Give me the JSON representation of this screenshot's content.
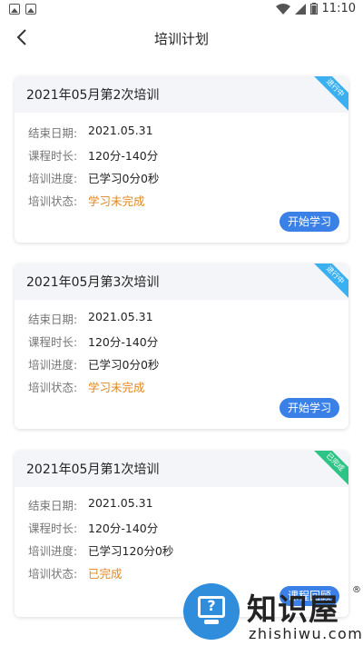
{
  "status_bar": {
    "time": "11:10"
  },
  "header": {
    "title": "培训计划"
  },
  "labels": {
    "end_date": "结束日期:",
    "duration": "课程时长:",
    "progress": "培训进度:",
    "status": "培训状态:"
  },
  "cards": [
    {
      "title": "2021年05月第2次培训",
      "ribbon": "进行中",
      "ribbon_color": "#3ab0f0",
      "end_date": "2021.05.31",
      "duration": "120分-140分",
      "progress": "已学习0分0秒",
      "status": "学习未完成",
      "status_color": "#e0871e",
      "button": "开始学习"
    },
    {
      "title": "2021年05月第3次培训",
      "ribbon": "进行中",
      "ribbon_color": "#3ab0f0",
      "end_date": "2021.05.31",
      "duration": "120分-140分",
      "progress": "已学习0分0秒",
      "status": "学习未完成",
      "status_color": "#e0871e",
      "button": "开始学习"
    },
    {
      "title": "2021年05月第1次培训",
      "ribbon": "已完成",
      "ribbon_color": "#2ec486",
      "end_date": "2021.05.31",
      "duration": "120分-140分",
      "progress": "已学习120分0秒",
      "status": "已完成",
      "status_color": "#e0871e",
      "button": "课程回顾"
    }
  ],
  "watermark": {
    "brand": "知识屋",
    "domain": "zhishiwu.com",
    "reg": "®"
  }
}
